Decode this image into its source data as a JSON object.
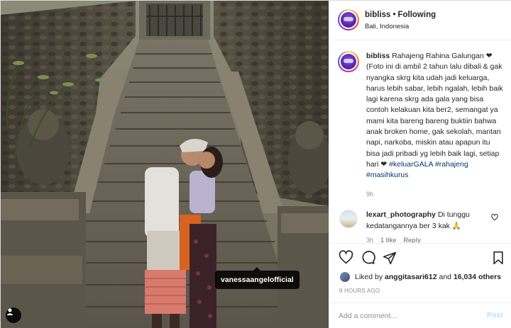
{
  "post": {
    "username": "bibliss",
    "follow_separator": "•",
    "follow_label": "Following",
    "location": "Bali, Indonesia",
    "photo_tag": "vanessaangelofficial",
    "caption": {
      "username": "bibliss",
      "text": "Rahajeng Rahina Galungan ❤ (Foto ini di ambil 2 tahun lalu dibali & gak nyangka skrg kita udah jadi keluarga, harus lebih sabar, lebih ngalah, lebih baik lagi karena skrg ada gala yang bisa contoh kelakuan kita ber2, semangat ya mami kita bareng bareng buktiin bahwa anak broken home, gak sekolah, mantan napi, narkoba, miskin atau apapun itu bisa jadi pribadi yg lebih baik lagi, setiap hari ❤",
      "hashtags": [
        "#keluarGALA",
        "#rahajeng",
        "#masihkurus"
      ],
      "time": "9h"
    },
    "comments": [
      {
        "username": "lexart_photography",
        "text": "Di tunggu kedatangannya ber 3 kak 🙏",
        "meta": [
          "3h",
          "1 like",
          "Reply"
        ]
      }
    ],
    "likes": {
      "prefix": "Liked by",
      "first_user": "anggitasari612",
      "joiner": "and",
      "others": "16,034 others"
    },
    "time_ago": "9 HOURS AGO",
    "add_comment_placeholder": "Add a comment...",
    "post_button": "Post"
  },
  "icons": [
    "heart-icon",
    "comment-icon",
    "share-icon",
    "bookmark-icon",
    "user-tag-icon",
    "like-comment-icon"
  ],
  "colors": {
    "link": "#00376b",
    "muted": "#8e8e8e",
    "post_disabled": "#b2dffc",
    "text": "#262626"
  }
}
